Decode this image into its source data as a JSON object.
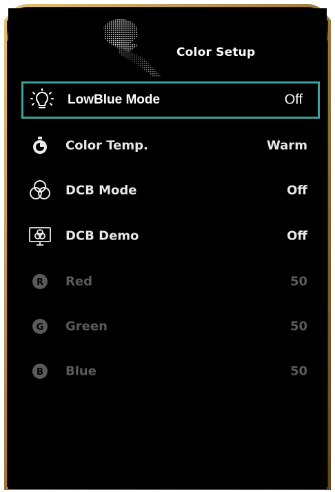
{
  "menu": {
    "title": "Color Setup"
  },
  "colors": {
    "selection_border": "#3aa3a0",
    "frame_gold": "#b8944a",
    "text_active": "#e8e8e8",
    "text_disabled": "#5a5a5a"
  },
  "items": [
    {
      "label": "LowBlue Mode",
      "value": "Off",
      "icon": "bulb-icon",
      "state": "selected"
    },
    {
      "label": "Color Temp.",
      "value": "Warm",
      "icon": "thermometer-dial-icon",
      "state": "active"
    },
    {
      "label": "DCB Mode",
      "value": "Off",
      "icon": "rgb-circles-icon",
      "state": "active"
    },
    {
      "label": "DCB Demo",
      "value": "Off",
      "icon": "monitor-rgb-icon",
      "state": "active"
    },
    {
      "label": "Red",
      "value": "50",
      "icon": "r-circle-icon",
      "state": "disabled"
    },
    {
      "label": "Green",
      "value": "50",
      "icon": "g-circle-icon",
      "state": "disabled"
    },
    {
      "label": "Blue",
      "value": "50",
      "icon": "b-circle-icon",
      "state": "disabled"
    }
  ]
}
